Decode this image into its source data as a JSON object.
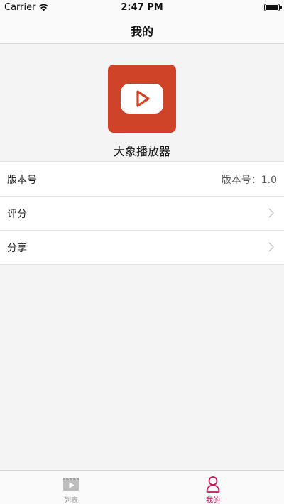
{
  "status_bar": {
    "carrier": "Carrier",
    "time": "2:47 PM",
    "battery_level": 1.0
  },
  "nav": {
    "title": "我的"
  },
  "app": {
    "name": "大象播放器",
    "logo_color": "#cf4429"
  },
  "list": {
    "version": {
      "label": "版本号",
      "value": "版本号：1.0"
    },
    "rating": {
      "label": "评分",
      "icon": "chevron-right-icon"
    },
    "share": {
      "label": "分享",
      "icon": "chevron-right-icon"
    }
  },
  "tab_bar": {
    "tabs": [
      {
        "label": "列表",
        "icon": "video-icon",
        "selected": false
      },
      {
        "label": "我的",
        "icon": "person-icon",
        "selected": true
      }
    ],
    "active_color": "#c2185b",
    "inactive_color": "#9e9e9e"
  }
}
